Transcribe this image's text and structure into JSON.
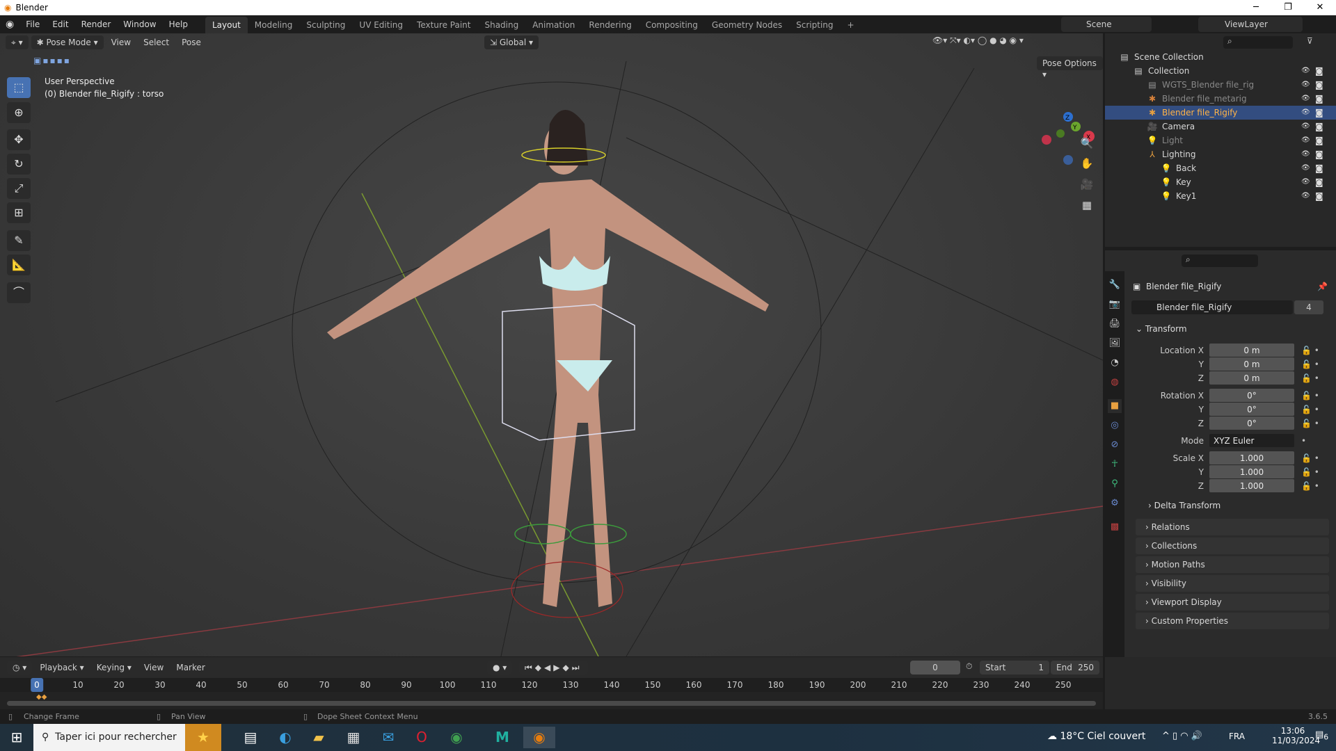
{
  "window": {
    "title": "Blender",
    "minimize": "─",
    "maximize": "❐",
    "close": "✕"
  },
  "menus": [
    "File",
    "Edit",
    "Render",
    "Window",
    "Help"
  ],
  "workspaces": [
    "Layout",
    "Modeling",
    "Sculpting",
    "UV Editing",
    "Texture Paint",
    "Shading",
    "Animation",
    "Rendering",
    "Compositing",
    "Geometry Nodes",
    "Scripting",
    "+"
  ],
  "scene": {
    "scene_name": "Scene",
    "view_layer": "ViewLayer"
  },
  "viewport": {
    "mode": "Pose Mode",
    "menus": [
      "View",
      "Select",
      "Pose"
    ],
    "orientation": "Global",
    "pose_options": "Pose Options",
    "overlay_title": "User Perspective",
    "overlay_subtitle": "(0) Blender file_Rigify : torso",
    "gizmo_axes": [
      "Z",
      "Y",
      "X"
    ]
  },
  "outliner": {
    "items": [
      {
        "label": "Scene Collection",
        "depth": 0
      },
      {
        "label": "Collection",
        "depth": 1
      },
      {
        "label": "WGTS_Blender file_rig",
        "depth": 2
      },
      {
        "label": "Blender file_metarig",
        "depth": 2
      },
      {
        "label": "Blender file_Rigify",
        "depth": 2,
        "selected": true
      },
      {
        "label": "Camera",
        "depth": 2
      },
      {
        "label": "Light",
        "depth": 2
      },
      {
        "label": "Lighting",
        "depth": 2
      },
      {
        "label": "Back",
        "depth": 3
      },
      {
        "label": "Key",
        "depth": 3
      },
      {
        "label": "Key1",
        "depth": 3
      }
    ]
  },
  "properties": {
    "object_name": "Blender file_Rigify",
    "data_name": "Blender file_Rigify",
    "users": "4",
    "transform_title": "Transform",
    "fields": [
      {
        "label": "Location X",
        "value": "0 m"
      },
      {
        "label": "Y",
        "value": "0 m"
      },
      {
        "label": "Z",
        "value": "0 m"
      },
      {
        "label": "Rotation X",
        "value": "0°"
      },
      {
        "label": "Y",
        "value": "0°"
      },
      {
        "label": "Z",
        "value": "0°"
      },
      {
        "label": "Mode",
        "value": "XYZ Euler"
      },
      {
        "label": "Scale X",
        "value": "1.000"
      },
      {
        "label": "Y",
        "value": "1.000"
      },
      {
        "label": "Z",
        "value": "1.000"
      }
    ],
    "delta": "Delta Transform",
    "panels": [
      "Relations",
      "Collections",
      "Motion Paths",
      "Visibility",
      "Viewport Display",
      "Custom Properties"
    ]
  },
  "timeline": {
    "menus": [
      "Playback",
      "Keying",
      "View",
      "Marker"
    ],
    "current_frame": "0",
    "start_label": "Start",
    "start": "1",
    "end_label": "End",
    "end": "250",
    "ticks": [
      "0",
      "10",
      "20",
      "30",
      "40",
      "50",
      "60",
      "70",
      "80",
      "90",
      "100",
      "110",
      "120",
      "130",
      "140",
      "150",
      "160",
      "170",
      "180",
      "190",
      "200",
      "210",
      "220",
      "230",
      "240",
      "250"
    ]
  },
  "statusbar": {
    "hints": [
      "Change Frame",
      "Pan View",
      "Dope Sheet Context Menu"
    ],
    "version": "3.6.5"
  },
  "taskbar": {
    "search_placeholder": "Taper ici pour rechercher",
    "weather": "18°C  Ciel couvert",
    "language": "FRA",
    "time": "13:06",
    "date": "11/03/2024",
    "notifications": "6"
  }
}
